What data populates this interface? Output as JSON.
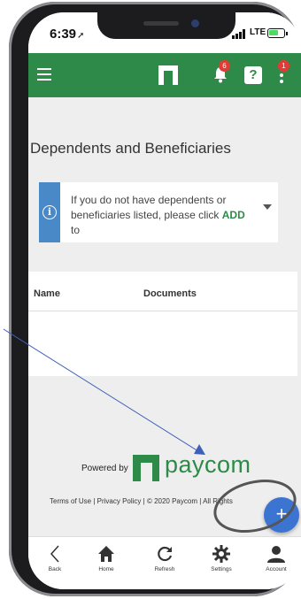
{
  "status_bar": {
    "time": "6:39",
    "network": "LTE"
  },
  "app_bar": {
    "notification_count": "6",
    "help_label": "?",
    "menu_badge": "1"
  },
  "page": {
    "title": "Dependents and Beneficiaries"
  },
  "info": {
    "text_before": "If you do not have dependents or beneficiaries listed, please click",
    "add_word": "ADD",
    "text_after": "to"
  },
  "table": {
    "columns": [
      "Name",
      "Documents"
    ]
  },
  "footer": {
    "powered_by": "Powered by",
    "brand": "paycom",
    "links": "Terms of Use | Privacy Policy | © 2020 Paycom | All Rights"
  },
  "fab": {
    "label": "+"
  },
  "bottom_nav": [
    {
      "label": "Back",
      "icon": "back-icon"
    },
    {
      "label": "Home",
      "icon": "home-icon"
    },
    {
      "label": "Refresh",
      "icon": "refresh-icon"
    },
    {
      "label": "Settings",
      "icon": "gear-icon"
    },
    {
      "label": "Account",
      "icon": "account-icon"
    }
  ],
  "colors": {
    "brand_green": "#2d8a48",
    "info_blue": "#4a89c8",
    "fab_blue": "#3b74d1",
    "badge_red": "#e53935"
  }
}
